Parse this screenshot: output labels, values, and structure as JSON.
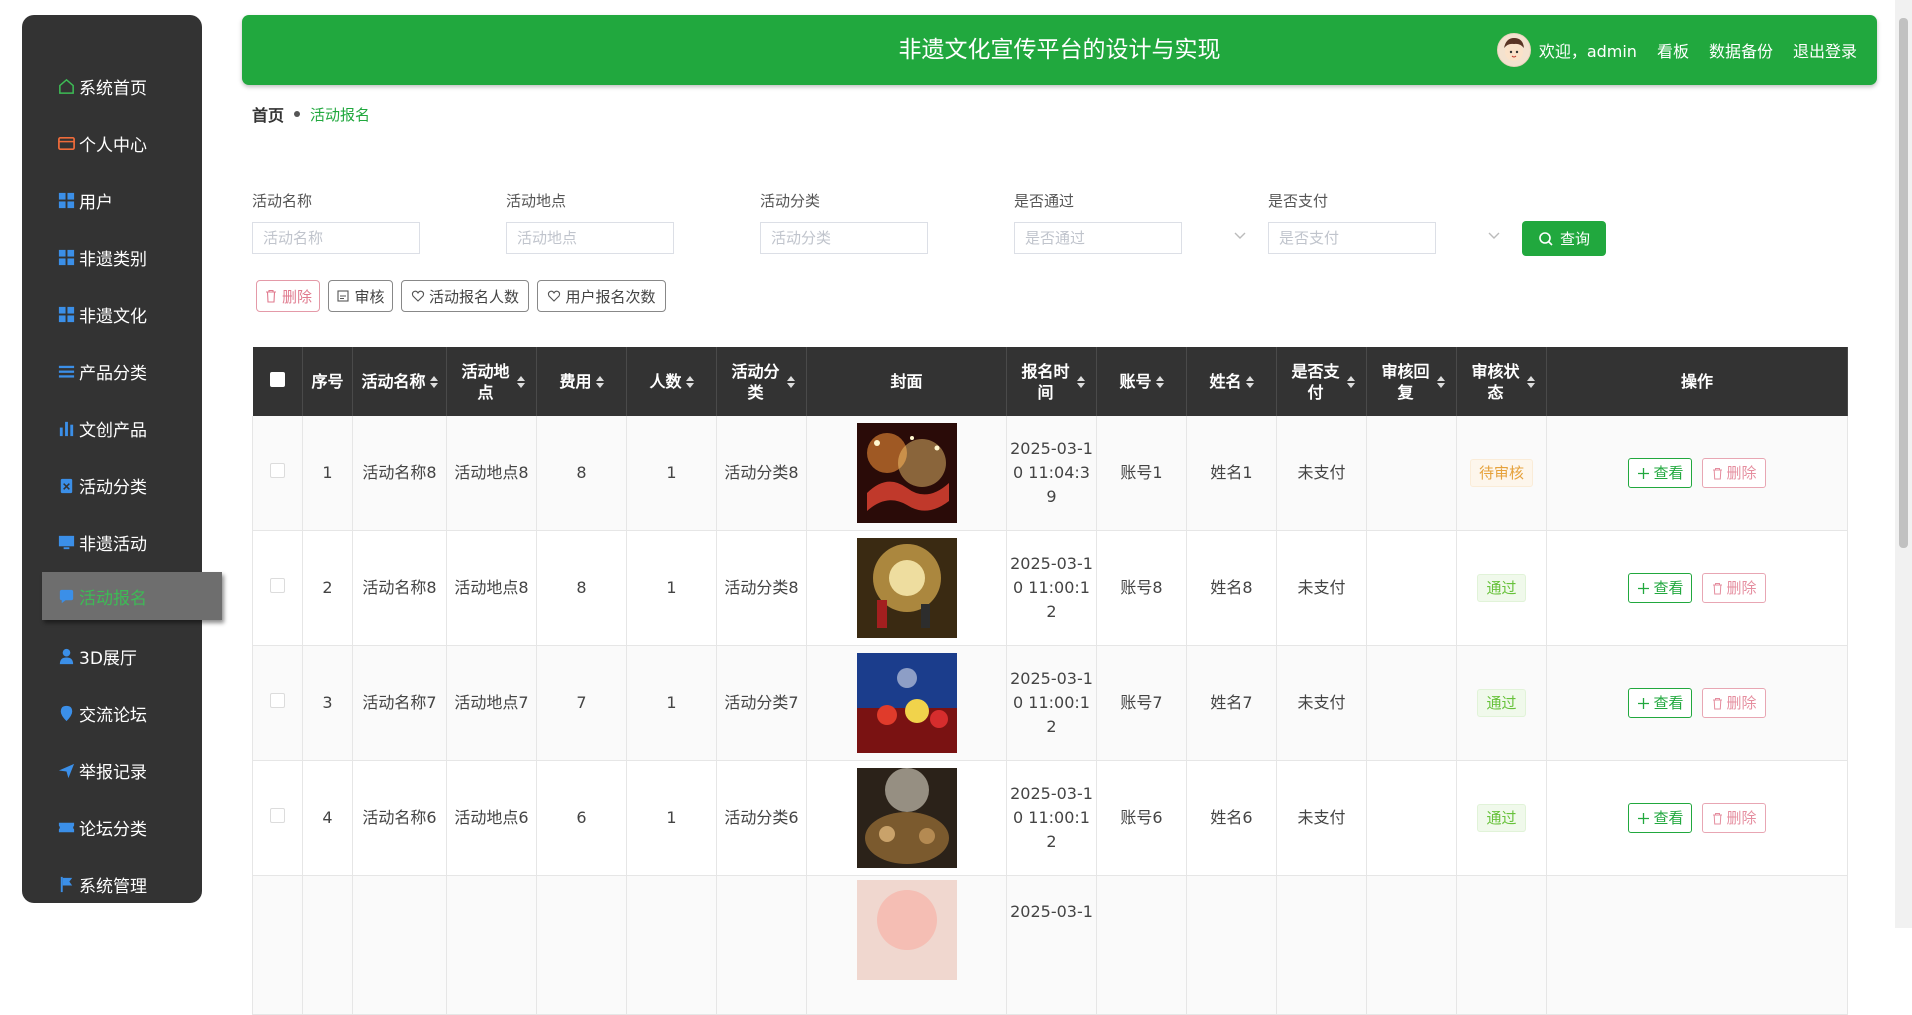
{
  "header": {
    "title": "非遗文化宣传平台的设计与实现",
    "welcome": "欢迎，admin",
    "links": [
      "看板",
      "数据备份",
      "退出登录"
    ]
  },
  "sidebar": {
    "items": [
      {
        "label": "系统首页",
        "icon": "home-icon"
      },
      {
        "label": "个人中心",
        "icon": "wallet-icon"
      },
      {
        "label": "用户",
        "icon": "grid-icon"
      },
      {
        "label": "非遗类别",
        "icon": "grid-icon"
      },
      {
        "label": "非遗文化",
        "icon": "grid-icon"
      },
      {
        "label": "产品分类",
        "icon": "list-icon"
      },
      {
        "label": "文创产品",
        "icon": "bar-chart-icon"
      },
      {
        "label": "活动分类",
        "icon": "clipboard-icon"
      },
      {
        "label": "非遗活动",
        "icon": "monitor-icon"
      },
      {
        "label": "活动报名",
        "icon": "chat-bubble-icon"
      },
      {
        "label": "3D展厅",
        "icon": "user-icon"
      },
      {
        "label": "交流论坛",
        "icon": "location-icon"
      },
      {
        "label": "举报记录",
        "icon": "send-icon"
      },
      {
        "label": "论坛分类",
        "icon": "ticket-icon"
      },
      {
        "label": "系统管理",
        "icon": "flag-icon"
      }
    ],
    "active_index": 9
  },
  "breadcrumb": {
    "home": "首页",
    "current": "活动报名"
  },
  "filters": {
    "activity_name": {
      "label": "活动名称",
      "placeholder": "活动名称"
    },
    "location": {
      "label": "活动地点",
      "placeholder": "活动地点"
    },
    "category": {
      "label": "活动分类",
      "placeholder": "活动分类"
    },
    "passed": {
      "label": "是否通过",
      "placeholder": "是否通过"
    },
    "paid": {
      "label": "是否支付",
      "placeholder": "是否支付"
    },
    "search_label": "查询"
  },
  "actions": {
    "delete": "删除",
    "review": "审核",
    "signup_count": "活动报名人数",
    "user_signup_times": "用户报名次数"
  },
  "table": {
    "headers": {
      "seq": "序号",
      "name": "活动名称",
      "location": "活动地点",
      "fee": "费用",
      "people": "人数",
      "category": "活动分类",
      "cover": "封面",
      "signup_time": "报名时间",
      "account": "账号",
      "realname": "姓名",
      "paid": "是否支付",
      "reply": "审核回复",
      "status": "审核状态",
      "ops": "操作"
    },
    "view_label": "查看",
    "delete_label": "删除",
    "rows": [
      {
        "seq": "1",
        "name": "活动名称8",
        "location": "活动地点8",
        "fee": "8",
        "people": "1",
        "category": "活动分类8",
        "time": "2025-03-10 11:04:39",
        "account": "账号1",
        "realname": "姓名1",
        "paid": "未支付",
        "reply": "",
        "status": "待审核",
        "status_type": "pending"
      },
      {
        "seq": "2",
        "name": "活动名称8",
        "location": "活动地点8",
        "fee": "8",
        "people": "1",
        "category": "活动分类8",
        "time": "2025-03-10 11:00:12",
        "account": "账号8",
        "realname": "姓名8",
        "paid": "未支付",
        "reply": "",
        "status": "通过",
        "status_type": "pass"
      },
      {
        "seq": "3",
        "name": "活动名称7",
        "location": "活动地点7",
        "fee": "7",
        "people": "1",
        "category": "活动分类7",
        "time": "2025-03-10 11:00:12",
        "account": "账号7",
        "realname": "姓名7",
        "paid": "未支付",
        "reply": "",
        "status": "通过",
        "status_type": "pass"
      },
      {
        "seq": "4",
        "name": "活动名称6",
        "location": "活动地点6",
        "fee": "6",
        "people": "1",
        "category": "活动分类6",
        "time": "2025-03-10 11:00:12",
        "account": "账号6",
        "realname": "姓名6",
        "paid": "未支付",
        "reply": "",
        "status": "通过",
        "status_type": "pass"
      },
      {
        "seq": "",
        "name": "",
        "location": "",
        "fee": "",
        "people": "",
        "category": "",
        "time": "2025-03-1",
        "account": "",
        "realname": "",
        "paid": "",
        "reply": "",
        "status": "",
        "status_type": "pass"
      }
    ]
  },
  "colors": {
    "primary": "#21a83e",
    "sidebar_bg": "#333333",
    "table_header_bg": "#333333"
  }
}
